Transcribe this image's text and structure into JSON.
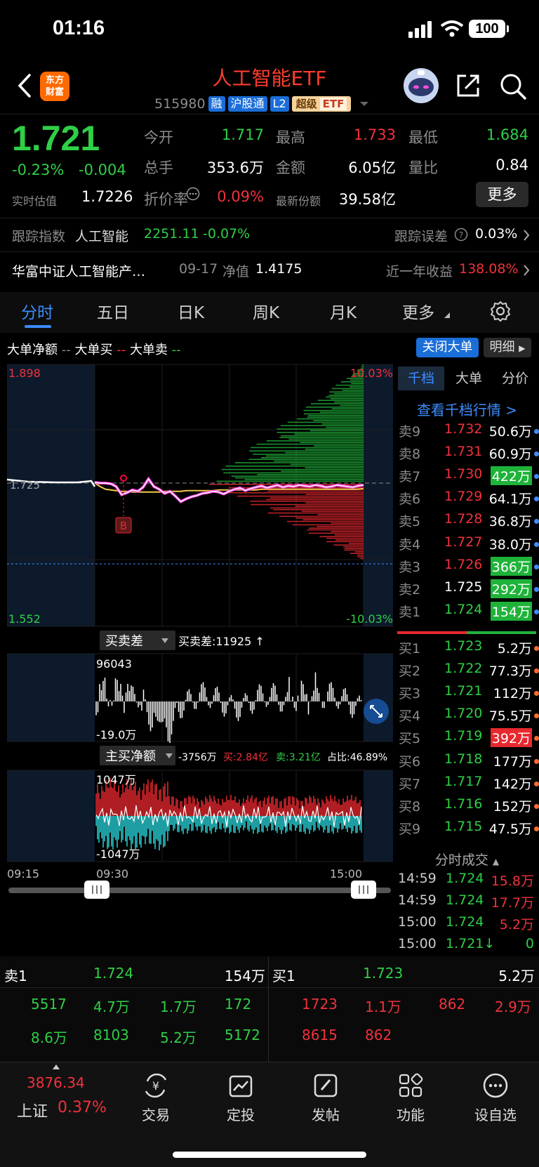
{
  "status": {
    "time": "01:16",
    "battery": "100"
  },
  "header": {
    "logo_line1": "东方",
    "logo_line2": "财富",
    "title": "人工智能ETF",
    "code": "515980",
    "tags": [
      "融",
      "沪股通",
      "L2"
    ],
    "super_tag": "超级",
    "super_tag_etf": "ETF"
  },
  "quote": {
    "price": "1.721",
    "change_pct": "-0.23%",
    "change_val": "-0.004",
    "realtime_est_label": "实时估值",
    "realtime_est": "1.7226",
    "open_label": "今开",
    "open": "1.717",
    "high_label": "最高",
    "high": "1.733",
    "low_label": "最低",
    "low": "1.684",
    "volume_label": "总手",
    "volume": "353.6万",
    "amount_label": "金额",
    "amount": "6.05亿",
    "vol_ratio_label": "量比",
    "vol_ratio": "0.84",
    "discount_label": "折价率",
    "discount": "0.09%",
    "shares_label": "最新份额",
    "shares": "39.58亿",
    "more": "更多"
  },
  "tracking": {
    "label": "跟踪指数",
    "index": "人工智能",
    "value": "2251.11",
    "pct": "-0.07%",
    "error_label": "跟踪误差",
    "error": "0.03%"
  },
  "fund": {
    "name": "华富中证人工智能产…",
    "nav_date": "09-17",
    "nav_label": "净值",
    "nav": "1.4175",
    "yield_label": "近一年收益",
    "yield": "138.08%"
  },
  "tabs": [
    "分时",
    "五日",
    "日K",
    "周K",
    "月K",
    "更多"
  ],
  "chart": {
    "legend_net": "大单净额",
    "legend_net_dash": "--",
    "legend_buy": "大单买",
    "legend_buy_dash": "--",
    "legend_sell": "大单卖",
    "legend_sell_dash": "--",
    "close_big": "关闭大单",
    "detail": "明细",
    "y_top": "1.898",
    "y_mid": "1.725",
    "y_bot": "1.552",
    "pct_top": "10.03%",
    "pct_bot": "-10.03%",
    "marker": "B",
    "diff_label": "买卖差",
    "diff_value": "买卖差:11925 ↑",
    "diff_top": "96043",
    "diff_bot": "-19.0万",
    "main_label": "主买净额",
    "main_value": "-3756万",
    "main_buy": "买:2.84亿",
    "main_sell": "卖:3.21亿",
    "main_ratio": "占比:46.89%",
    "main_top": "1047万",
    "main_bot": "-1047万",
    "time_start": "09:15",
    "time_open": "09:30",
    "time_end": "15:00",
    "series": [
      {
        "name": "价格",
        "color": "#ffffff"
      },
      {
        "name": "均价",
        "color": "#f2c94c"
      }
    ],
    "price_series": [
      1.726,
      1.725,
      1.725,
      1.724,
      1.72,
      1.708,
      1.711,
      1.715,
      1.713,
      1.719,
      1.731,
      1.72,
      1.716,
      1.71,
      1.713,
      1.706,
      1.698,
      1.702,
      1.705,
      1.707,
      1.71,
      1.711,
      1.713,
      1.712,
      1.709,
      1.713,
      1.716,
      1.718,
      1.714,
      1.717,
      1.719,
      1.721,
      1.718,
      1.72,
      1.722,
      1.719,
      1.721,
      1.72,
      1.722,
      1.721,
      1.72,
      1.722,
      1.721,
      1.719,
      1.72,
      1.722,
      1.721,
      1.72,
      1.719,
      1.721,
      1.722
    ],
    "avg_series": [
      1.725,
      1.72,
      1.716,
      1.715,
      1.714,
      1.713,
      1.713,
      1.712,
      1.712,
      1.712,
      1.712,
      1.712,
      1.712,
      1.713,
      1.713,
      1.713,
      1.713,
      1.714,
      1.714,
      1.714,
      1.714,
      1.714,
      1.714,
      1.715,
      1.715,
      1.715,
      1.715,
      1.715,
      1.715,
      1.715,
      1.715,
      1.716,
      1.716,
      1.716,
      1.716,
      1.716,
      1.716,
      1.716,
      1.716,
      1.716,
      1.716,
      1.716,
      1.716,
      1.716,
      1.716,
      1.716,
      1.716,
      1.716,
      1.716,
      1.716,
      1.717
    ]
  },
  "orderbook": {
    "tabs": [
      "千档",
      "大单",
      "分价"
    ],
    "view_link": "查看千档行情 >",
    "sells": [
      {
        "k": "卖9",
        "p": "1.732",
        "v": "50.6万",
        "dot": "#3c8cff",
        "hl": ""
      },
      {
        "k": "卖8",
        "p": "1.731",
        "v": "60.9万",
        "dot": "#3c8cff",
        "hl": ""
      },
      {
        "k": "卖7",
        "p": "1.730",
        "v": "422万",
        "dot": "#3c8cff",
        "hl": "g"
      },
      {
        "k": "卖6",
        "p": "1.729",
        "v": "64.1万",
        "dot": "#3c8cff",
        "hl": ""
      },
      {
        "k": "卖5",
        "p": "1.728",
        "v": "36.8万",
        "dot": "#3c8cff",
        "hl": ""
      },
      {
        "k": "卖4",
        "p": "1.727",
        "v": "38.0万",
        "dot": "#3c8cff",
        "hl": ""
      },
      {
        "k": "卖3",
        "p": "1.726",
        "v": "366万",
        "dot": "#3c8cff",
        "hl": "g"
      },
      {
        "k": "卖2",
        "p": "1.725",
        "v": "292万",
        "dot": "#3c8cff",
        "hl": "g"
      },
      {
        "k": "卖1",
        "p": "1.724",
        "v": "154万",
        "dot": "#3c8cff",
        "hl": "g"
      }
    ],
    "buys": [
      {
        "k": "买1",
        "p": "1.723",
        "v": "5.2万",
        "dot": "#ff6a2a",
        "hl": ""
      },
      {
        "k": "买2",
        "p": "1.722",
        "v": "77.3万",
        "dot": "#ff6a2a",
        "hl": ""
      },
      {
        "k": "买3",
        "p": "1.721",
        "v": "112万",
        "dot": "#ff6a2a",
        "hl": ""
      },
      {
        "k": "买4",
        "p": "1.720",
        "v": "75.5万",
        "dot": "#ff6a2a",
        "hl": ""
      },
      {
        "k": "买5",
        "p": "1.719",
        "v": "392万",
        "dot": "#ff6a2a",
        "hl": "r"
      },
      {
        "k": "买6",
        "p": "1.718",
        "v": "177万",
        "dot": "#ff6a2a",
        "hl": ""
      },
      {
        "k": "买7",
        "p": "1.717",
        "v": "142万",
        "dot": "#ff6a2a",
        "hl": ""
      },
      {
        "k": "买8",
        "p": "1.716",
        "v": "152万",
        "dot": "#ff6a2a",
        "hl": ""
      },
      {
        "k": "买9",
        "p": "1.715",
        "v": "47.5万",
        "dot": "#ff6a2a",
        "hl": ""
      }
    ],
    "trades_title": "分时成交",
    "trades": [
      {
        "t": "14:59",
        "p": "1.724",
        "v": "15.8万",
        "vc": "red"
      },
      {
        "t": "14:59",
        "p": "1.724",
        "v": "17.7万",
        "vc": "red"
      },
      {
        "t": "15:00",
        "p": "1.724",
        "v": "5.2万",
        "vc": "red"
      },
      {
        "t": "15:00",
        "p": "1.721↓",
        "v": "0",
        "vc": "green"
      }
    ]
  },
  "bottom_book": {
    "sell_label": "卖1",
    "sell_price": "1.724",
    "sell_vol": "154万",
    "buy_label": "买1",
    "buy_price": "1.723",
    "buy_vol": "5.2万",
    "sell_row1": [
      "5517",
      "4.7万",
      "1.7万",
      "172"
    ],
    "sell_row2": [
      "8.6万",
      "8103",
      "5.2万",
      "5172"
    ],
    "buy_row1": [
      "1723",
      "1.1万",
      "862",
      "2.9万"
    ],
    "buy_row2": [
      "8615",
      "862"
    ]
  },
  "nav": {
    "index_value": "3876.34",
    "index_name": "上证",
    "index_pct": "0.37%",
    "items": [
      "交易",
      "定投",
      "发帖",
      "功能",
      "设自选"
    ]
  }
}
